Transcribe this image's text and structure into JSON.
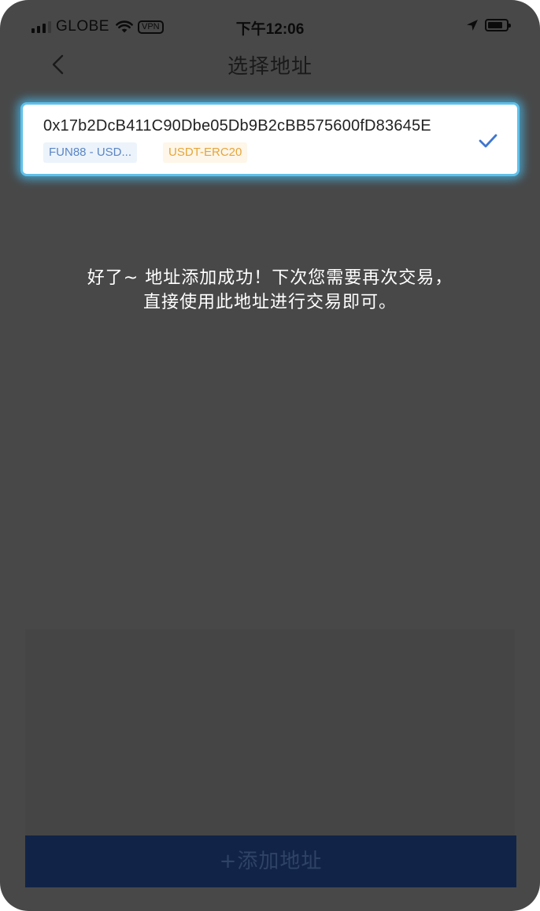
{
  "status_bar": {
    "carrier": "GLOBE",
    "vpn_label": "VPN",
    "time": "下午12:06",
    "icons": [
      "signal-icon",
      "wifi-icon",
      "vpn-icon",
      "location-arrow-icon",
      "battery-icon"
    ]
  },
  "header": {
    "title": "选择地址",
    "back_icon": "chevron-left-icon"
  },
  "address_card": {
    "address": "0x17b2DcB411C90Dbe05Db9B2cBB575600fD83645E",
    "brand_tag": "FUN88 - USD...",
    "network_tag": "USDT-ERC20",
    "selected": true,
    "check_icon": "checkmark-icon"
  },
  "message": {
    "line1": "好了~ 地址添加成功！下次您需要再次交易，",
    "line2": "直接使用此地址进行交易即可。"
  },
  "footer": {
    "add_button_label": "+添加地址"
  },
  "colors": {
    "overlay": "#484848",
    "card_highlight": "#5fc0ea",
    "brand_tag_text": "#5b86c4",
    "network_tag_text": "#e6a53a",
    "check": "#3f76d0",
    "button_bg": "#112448"
  }
}
